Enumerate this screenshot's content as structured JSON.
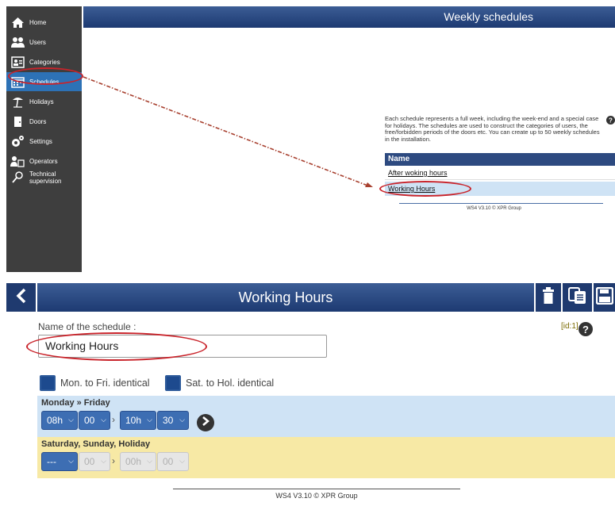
{
  "sidebar": {
    "items": [
      {
        "label": "Home",
        "icon": "home-icon"
      },
      {
        "label": "Users",
        "icon": "users-icon"
      },
      {
        "label": "Categories",
        "icon": "categories-icon"
      },
      {
        "label": "Schedules",
        "icon": "schedules-icon",
        "active": true
      },
      {
        "label": "Holidays",
        "icon": "holidays-icon"
      },
      {
        "label": "Doors",
        "icon": "door-icon"
      },
      {
        "label": "Settings",
        "icon": "settings-icon"
      },
      {
        "label": "Operators",
        "icon": "operators-icon"
      },
      {
        "label": "Technical supervision",
        "icon": "magnifier-icon"
      }
    ]
  },
  "list_page": {
    "title": "Weekly schedules",
    "description": "Each schedule represents a full week, including the week-end and a special case for holidays. The schedules are used to construct the categories of users, the free/forbidden periods of the doors etc. You can create up to 50 weekly schedules in the installation.",
    "table": {
      "header": "Name",
      "rows": [
        "After woking hours",
        "Working Hours"
      ]
    },
    "footer": "WS4 V3.10 © XPR Group"
  },
  "edit_page": {
    "title": "Working Hours",
    "name_label": "Name of the schedule :",
    "name_value": "Working Hours",
    "id_text": "[id:1]",
    "checkboxes": {
      "mon_fri": "Mon. to Fri. identical",
      "sat_hol": "Sat. to Hol. identical"
    },
    "weekday": {
      "title": "Monday » Friday",
      "start_hour": "08h",
      "start_min": "00",
      "end_hour": "10h",
      "end_min": "30"
    },
    "weekend": {
      "title": "Saturday, Sunday, Holiday",
      "start_hour": "---",
      "start_min": "00",
      "end_hour": "00h",
      "end_min": "00"
    },
    "footer": "WS4 V3.10 © XPR Group"
  },
  "colors": {
    "header_bar": "#2d4a80",
    "sidebar_bg": "#3e3e3e",
    "active_nav": "#2d72b6",
    "highlight_ellipse": "#c9242b",
    "weekday_band": "#cfe3f5",
    "weekend_band": "#f7e9a5"
  }
}
